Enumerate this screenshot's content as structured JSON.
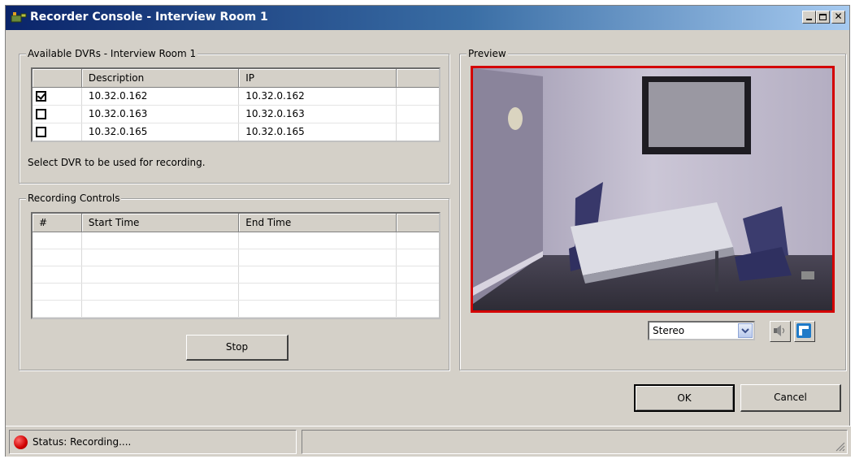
{
  "window": {
    "title": "Recorder Console - Interview Room 1",
    "buttons": [
      "minimize",
      "maximize",
      "close"
    ]
  },
  "dvr_group": {
    "legend": "Available DVRs - Interview Room 1",
    "columns": [
      "Description",
      "IP"
    ],
    "rows": [
      {
        "checked": true,
        "description": "10.32.0.162",
        "ip": "10.32.0.162"
      },
      {
        "checked": false,
        "description": "10.32.0.163",
        "ip": "10.32.0.163"
      },
      {
        "checked": false,
        "description": "10.32.0.165",
        "ip": "10.32.0.165"
      }
    ],
    "hint": "Select DVR to be used for recording."
  },
  "recording_group": {
    "legend": "Recording Controls",
    "columns": [
      "#",
      "Start Time",
      "End Time"
    ],
    "empty_row_count": 5,
    "stop_label": "Stop"
  },
  "preview_group": {
    "legend": "Preview",
    "audio_select": "Stereo",
    "speaker_icon": "speaker-icon",
    "popout_icon": "popout-icon",
    "border_color": "#d40000"
  },
  "dialog": {
    "ok_label": "OK",
    "cancel_label": "Cancel"
  },
  "status": {
    "text": "Status: Recording....",
    "indicator_color": "#d00000"
  }
}
